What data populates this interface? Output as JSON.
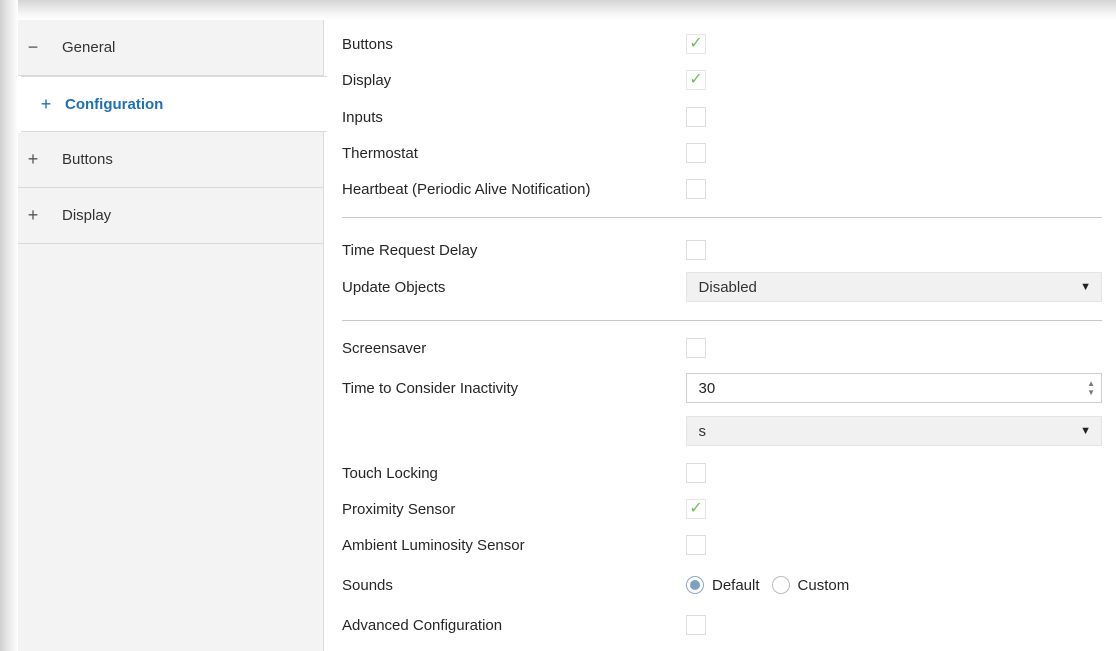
{
  "sidebar": {
    "items": [
      {
        "glyph": "−",
        "label": "General",
        "icon": "minus-icon"
      },
      {
        "glyph": "+",
        "label": "Configuration",
        "icon": "plus-icon"
      },
      {
        "glyph": "+",
        "label": "Buttons",
        "icon": "plus-icon"
      },
      {
        "glyph": "+",
        "label": "Display",
        "icon": "plus-icon"
      }
    ]
  },
  "settings": {
    "buttons": {
      "label": "Buttons",
      "checked": true
    },
    "display": {
      "label": "Display",
      "checked": true
    },
    "inputs": {
      "label": "Inputs",
      "checked": false
    },
    "thermostat": {
      "label": "Thermostat",
      "checked": false
    },
    "heartbeat": {
      "label": "Heartbeat (Periodic Alive Notification)",
      "checked": false
    },
    "time_request_delay": {
      "label": "Time Request Delay",
      "checked": false
    },
    "update_objects": {
      "label": "Update Objects",
      "value": "Disabled"
    },
    "screensaver": {
      "label": "Screensaver",
      "checked": false
    },
    "inactivity": {
      "label": "Time to Consider Inactivity",
      "value": "30",
      "unit": "s"
    },
    "touch_locking": {
      "label": "Touch Locking",
      "checked": false
    },
    "proximity": {
      "label": "Proximity Sensor",
      "checked": true
    },
    "ambient": {
      "label": "Ambient Luminosity Sensor",
      "checked": false
    },
    "sounds": {
      "label": "Sounds",
      "options": [
        "Default",
        "Custom"
      ],
      "selected": "Default"
    },
    "advanced": {
      "label": "Advanced Configuration",
      "checked": false
    }
  },
  "glyphs": {
    "check": "✓",
    "caret": "▼",
    "spin_up": "▲",
    "spin_down": "▼"
  },
  "colors": {
    "accent": "#1f6fb5",
    "check": "#6dbf5a"
  }
}
